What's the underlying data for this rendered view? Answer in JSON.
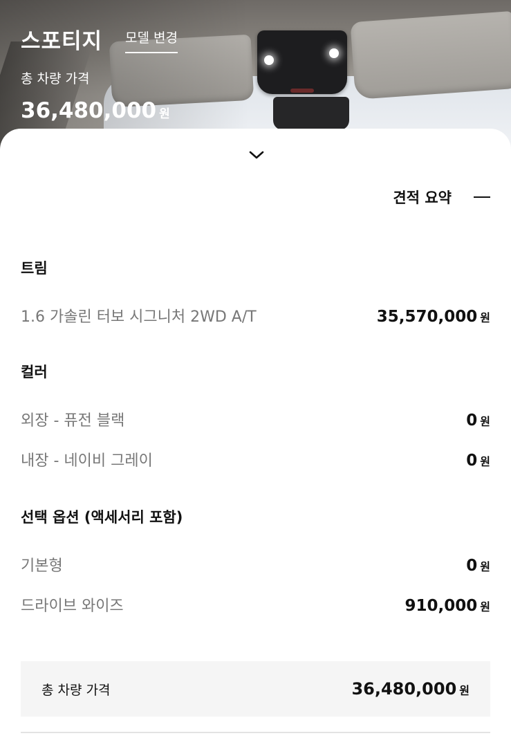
{
  "header": {
    "model_name": "스포티지",
    "model_change_label": "모델 변경",
    "total_label": "총 차량 가격",
    "total_price": "36,480,000",
    "currency_unit": "원"
  },
  "summary": {
    "title": "견적 요약",
    "expand_icon": "chevron-down-icon",
    "collapse_icon": "minus-icon"
  },
  "sections": {
    "trim": {
      "title": "트림",
      "items": [
        {
          "name": "1.6 가솔린 터보 시그니처 2WD A/T",
          "price": "35,570,000",
          "unit": "원"
        }
      ]
    },
    "color": {
      "title": "컬러",
      "items": [
        {
          "name": "외장 - 퓨전 블랙",
          "price": "0",
          "unit": "원"
        },
        {
          "name": "내장 - 네이비 그레이",
          "price": "0",
          "unit": "원"
        }
      ]
    },
    "options": {
      "title": "선택 옵션 (액세서리 포함)",
      "items": [
        {
          "name": "기본형",
          "price": "0",
          "unit": "원"
        },
        {
          "name": "드라이브 와이즈",
          "price": "910,000",
          "unit": "원"
        }
      ]
    }
  },
  "total": {
    "label": "총 차량 가격",
    "price": "36,480,000",
    "unit": "원"
  }
}
